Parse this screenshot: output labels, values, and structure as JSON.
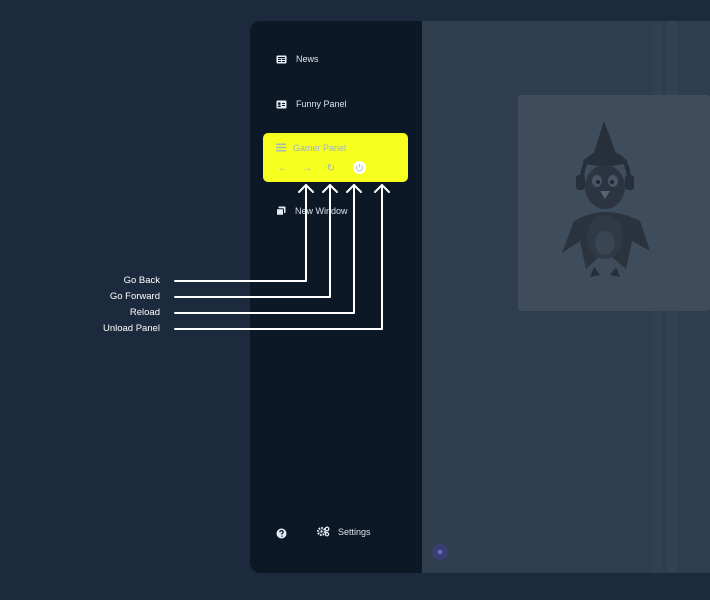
{
  "sidebar": {
    "items": [
      {
        "label": "News",
        "icon": "newspaper-icon"
      },
      {
        "label": "Funny Panel",
        "icon": "id-card-icon"
      },
      {
        "label": "Gamer Panel",
        "icon": "list-icon",
        "active": true
      },
      {
        "label": "New Window",
        "icon": "windows-icon"
      }
    ],
    "active_controls": [
      {
        "label": "Go Back",
        "glyph": "←",
        "icon": "arrow-left-icon"
      },
      {
        "label": "Go Forward",
        "glyph": "→",
        "icon": "arrow-right-icon"
      },
      {
        "label": "Reload",
        "glyph": "↻",
        "icon": "reload-icon"
      },
      {
        "label": "Unload Panel",
        "glyph": "⏻",
        "icon": "power-icon"
      }
    ],
    "footer": {
      "help_icon": "question-circle-icon",
      "settings_label": "Settings",
      "settings_icon": "gears-icon"
    }
  },
  "annotations": [
    {
      "label": "Go Back"
    },
    {
      "label": "Go Forward"
    },
    {
      "label": "Reload"
    },
    {
      "label": "Unload Panel"
    }
  ],
  "colors": {
    "highlight": "#f6ff1e",
    "sidebar_bg": "#0c1826",
    "page_bg": "#1b2a3c",
    "content_bg": "#2f3e4e"
  }
}
